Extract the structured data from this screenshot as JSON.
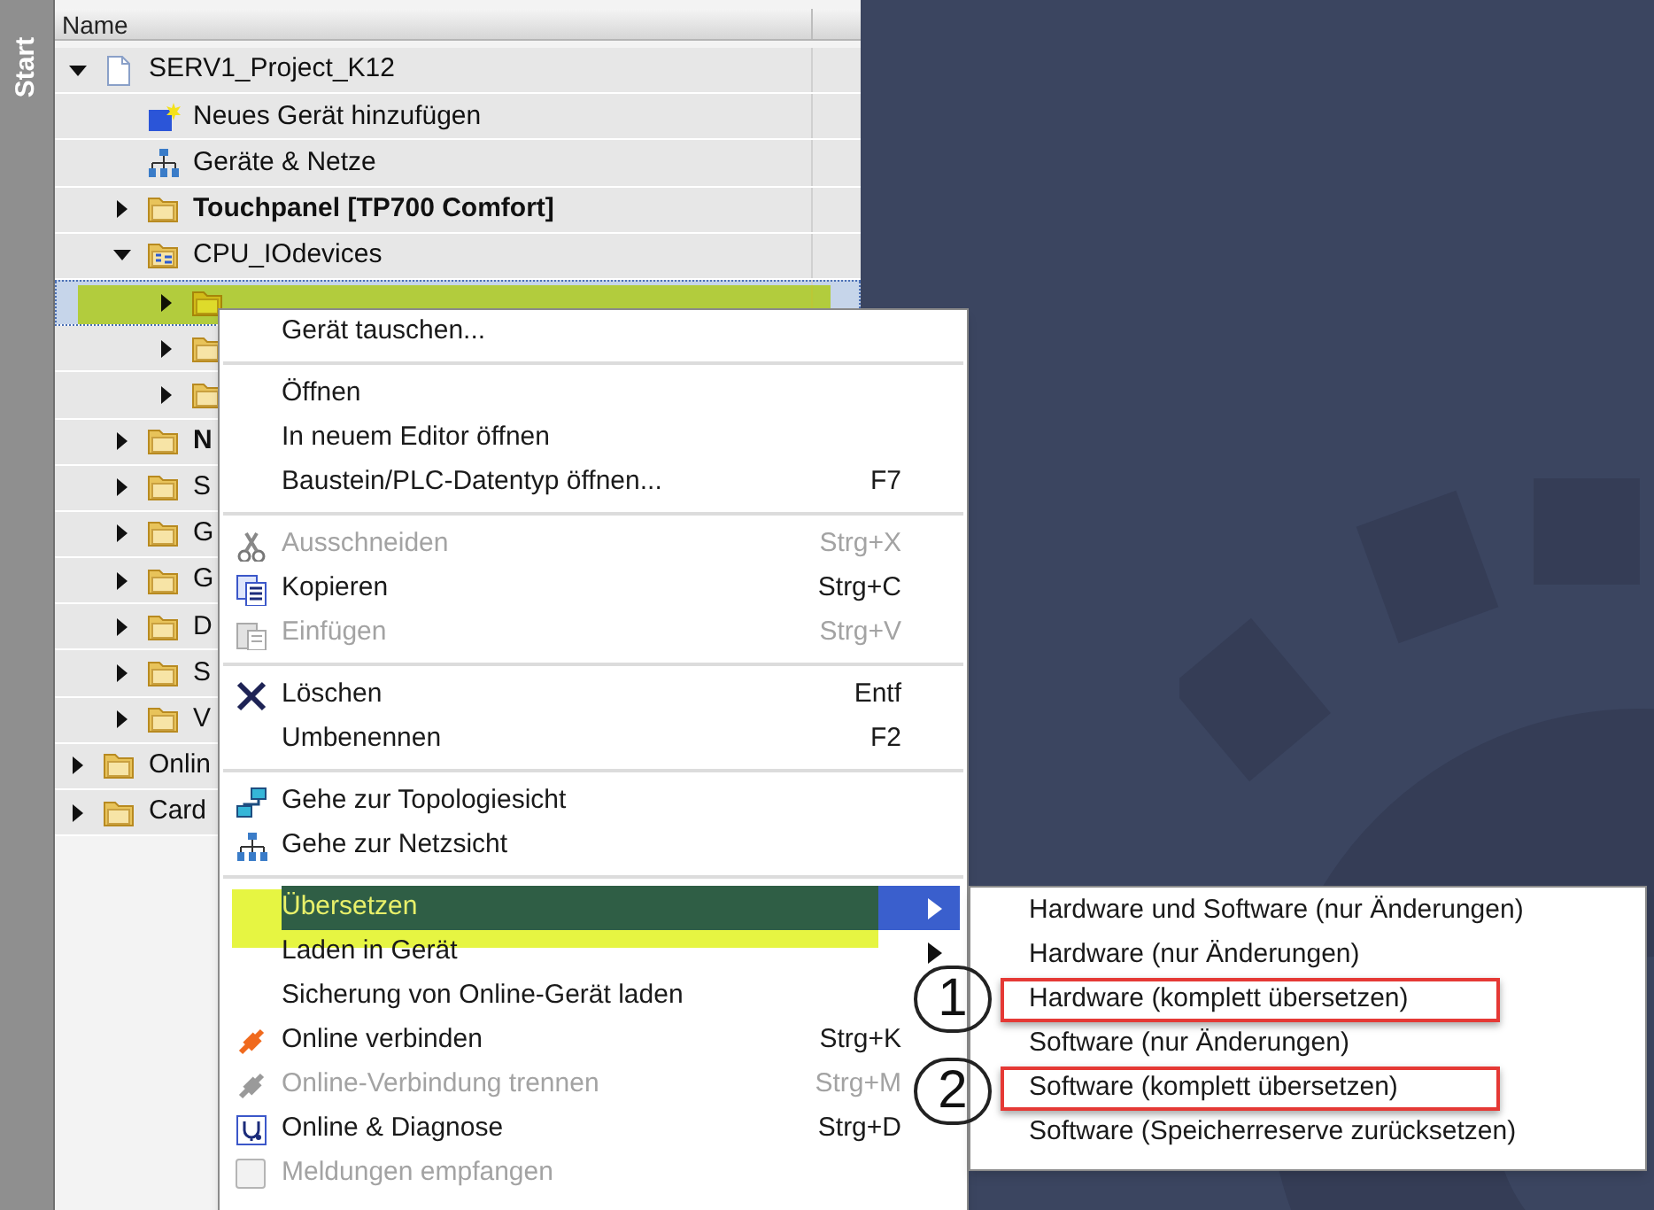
{
  "sidebar_tab": {
    "label": "Start"
  },
  "tree_header": {
    "label": "Name"
  },
  "tree": [
    {
      "label": "SERV1_Project_K12",
      "kind": "project",
      "expanded": true,
      "selected": false,
      "highlighted": false,
      "bold": false,
      "children": [
        {
          "label": "Neues Gerät hinzufügen",
          "kind": "add-device",
          "selected": false,
          "highlighted": false,
          "bold": false
        },
        {
          "label": "Geräte & Netze",
          "kind": "network",
          "selected": false,
          "highlighted": false,
          "bold": false
        },
        {
          "label": "Touchpanel [TP700 Comfort]",
          "kind": "folder",
          "expanded": false,
          "selected": false,
          "highlighted": false,
          "bold": true
        },
        {
          "label": "CPU_IOdevices",
          "kind": "group",
          "expanded": true,
          "selected": false,
          "highlighted": false,
          "bold": false,
          "children": [
            {
              "kind": "folder",
              "expanded": false,
              "selected": true,
              "highlighted": true
            },
            {
              "kind": "folder",
              "expanded": false,
              "selected": false,
              "highlighted": false
            },
            {
              "kind": "folder",
              "expanded": false,
              "selected": false,
              "highlighted": false
            }
          ]
        },
        {
          "label": "N",
          "kind": "folder",
          "expanded": false,
          "selected": false,
          "highlighted": false,
          "bold": true
        },
        {
          "label": "S",
          "kind": "folder",
          "expanded": false,
          "selected": false,
          "highlighted": false,
          "bold": false
        },
        {
          "label": "G",
          "kind": "folder",
          "expanded": false,
          "selected": false,
          "highlighted": false,
          "bold": false
        },
        {
          "label": "G",
          "kind": "folder",
          "expanded": false,
          "selected": false,
          "highlighted": false,
          "bold": false
        },
        {
          "label": "D",
          "kind": "folder",
          "expanded": false,
          "selected": false,
          "highlighted": false,
          "bold": false
        },
        {
          "label": "S",
          "kind": "folder",
          "expanded": false,
          "selected": false,
          "highlighted": false,
          "bold": false
        },
        {
          "label": "V",
          "kind": "folder",
          "expanded": false,
          "selected": false,
          "highlighted": false,
          "bold": false
        }
      ]
    },
    {
      "label": "Onlin",
      "kind": "folder",
      "expanded": false,
      "selected": false,
      "highlighted": false,
      "bold": false
    },
    {
      "label": "Card",
      "kind": "folder",
      "expanded": false,
      "selected": false,
      "highlighted": false,
      "bold": false
    }
  ],
  "context_menu": [
    {
      "kind": "command",
      "label": "Gerät tauschen...",
      "disabled": false,
      "selected": false,
      "highlighted": false
    },
    {
      "kind": "separator"
    },
    {
      "kind": "command",
      "label": "Öffnen",
      "disabled": false,
      "selected": false,
      "highlighted": false
    },
    {
      "kind": "command",
      "label": "In neuem Editor öffnen",
      "disabled": false,
      "selected": false,
      "highlighted": false
    },
    {
      "kind": "command",
      "label": "Baustein/PLC-Datentyp öffnen...",
      "shortcut": "F7",
      "disabled": false,
      "selected": false,
      "highlighted": false
    },
    {
      "kind": "separator"
    },
    {
      "kind": "command",
      "label": "Ausschneiden",
      "shortcut": "Strg+X",
      "disabled": true,
      "selected": false,
      "highlighted": false
    },
    {
      "kind": "command",
      "label": "Kopieren",
      "shortcut": "Strg+C",
      "disabled": false,
      "selected": false,
      "highlighted": false
    },
    {
      "kind": "command",
      "label": "Einfügen",
      "shortcut": "Strg+V",
      "disabled": true,
      "selected": false,
      "highlighted": false
    },
    {
      "kind": "separator"
    },
    {
      "kind": "command",
      "label": "Löschen",
      "shortcut": "Entf",
      "disabled": false,
      "selected": false,
      "highlighted": false
    },
    {
      "kind": "command",
      "label": "Umbenennen",
      "shortcut": "F2",
      "disabled": false,
      "selected": false,
      "highlighted": false
    },
    {
      "kind": "separator"
    },
    {
      "kind": "command",
      "label": "Gehe zur Topologiesicht",
      "disabled": false,
      "selected": false,
      "highlighted": false
    },
    {
      "kind": "command",
      "label": "Gehe zur Netzsicht",
      "disabled": false,
      "selected": false,
      "highlighted": false
    },
    {
      "kind": "separator"
    },
    {
      "kind": "submenu",
      "label": "Übersetzen",
      "disabled": false,
      "selected": true,
      "highlighted": true
    },
    {
      "kind": "submenu",
      "label": "Laden in Gerät",
      "disabled": false,
      "selected": false,
      "highlighted": false
    },
    {
      "kind": "command",
      "label": "Sicherung von Online-Gerät laden",
      "disabled": false,
      "selected": false,
      "highlighted": false
    },
    {
      "kind": "command",
      "label": "Online verbinden",
      "shortcut": "Strg+K",
      "disabled": false,
      "selected": false,
      "highlighted": false
    },
    {
      "kind": "command",
      "label": "Online-Verbindung trennen",
      "shortcut": "Strg+M",
      "disabled": true,
      "selected": false,
      "highlighted": false
    },
    {
      "kind": "command",
      "label": "Online & Diagnose",
      "shortcut": "Strg+D",
      "disabled": false,
      "selected": false,
      "highlighted": false
    },
    {
      "kind": "checkbox",
      "label": "Meldungen empfangen",
      "disabled": true,
      "selected": false,
      "highlighted": false
    }
  ],
  "submenu": [
    {
      "label": "Hardware und Software (nur Änderungen)",
      "boxed": false
    },
    {
      "label": "Hardware (nur Änderungen)",
      "boxed": false
    },
    {
      "label": "Hardware (komplett übersetzen)",
      "boxed": true
    },
    {
      "label": "Software (nur Änderungen)",
      "boxed": false
    },
    {
      "label": "Software (komplett übersetzen)",
      "boxed": true
    },
    {
      "label": "Software (Speicherreserve zurücksetzen)",
      "boxed": false
    }
  ],
  "callouts": [
    {
      "number": "1"
    },
    {
      "number": "2"
    }
  ]
}
